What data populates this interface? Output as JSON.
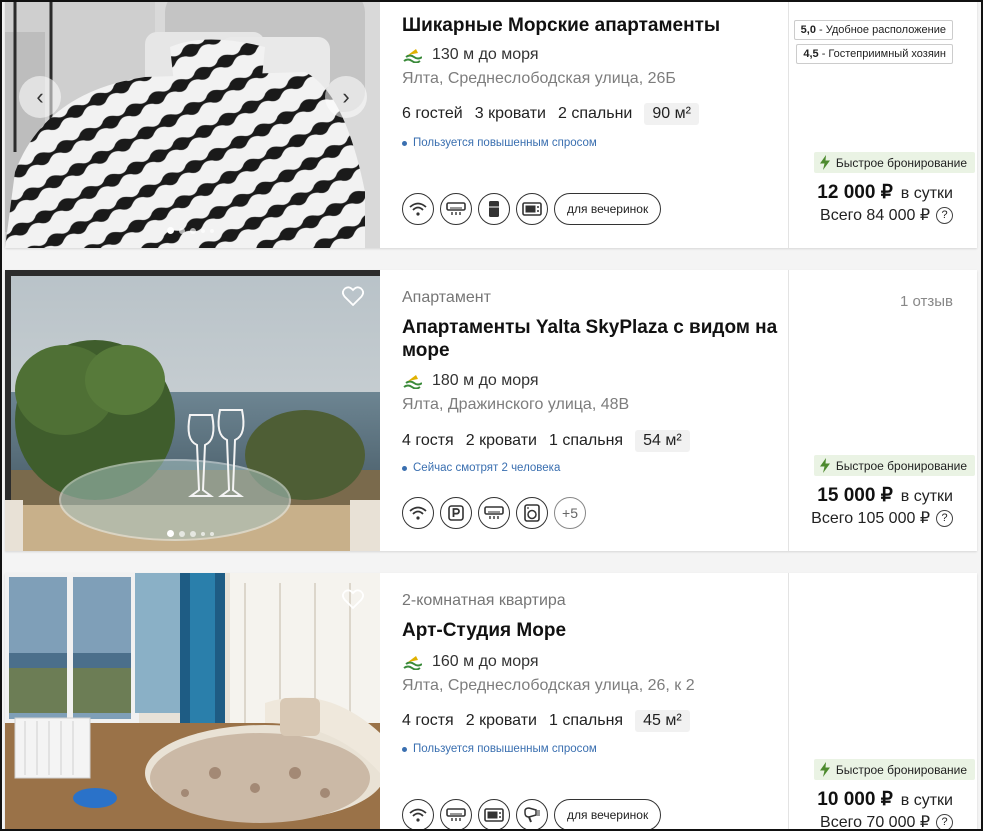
{
  "listings": [
    {
      "property_type": "",
      "title": "Шикарные Морские апартаменты",
      "sea_distance": "130 м до моря",
      "address": "Ялта, Среднеслободская улица, 26Б",
      "guests": "6 гостей",
      "beds": "3 кровати",
      "bedrooms": "2 спальни",
      "area": "90 м²",
      "note": "Пользуется повышенным спросом",
      "amenity_icons": [
        "wifi-icon",
        "air-conditioner-icon",
        "fridge-icon",
        "microwave-icon"
      ],
      "tag": "для вечеринок",
      "ratings": [
        {
          "score": "5,0",
          "label": "Удобное расположение"
        },
        {
          "score": "4,5",
          "label": "Гостеприимный хозяин"
        }
      ],
      "badge": "Быстрое бронирование",
      "price": "12 000 ₽",
      "price_unit": "в сутки",
      "total": "Всего 84 000 ₽",
      "total_help": "?"
    },
    {
      "property_type": "Апартамент",
      "title": "Апартаменты Yalta SkyPlaza с видом на море",
      "sea_distance": "180 м до моря",
      "address": "Ялта, Дражинского улица, 48В",
      "guests": "4 гостя",
      "beds": "2 кровати",
      "bedrooms": "1 спальня",
      "area": "54 м²",
      "note": "Сейчас смотрят 2 человека",
      "amenity_icons": [
        "wifi-icon",
        "parking-icon",
        "air-conditioner-icon",
        "washing-machine-icon"
      ],
      "more": "+5",
      "reviews": "1 отзыв",
      "badge": "Быстрое бронирование",
      "price": "15 000 ₽",
      "price_unit": "в сутки",
      "total": "Всего 105 000 ₽",
      "total_help": "?"
    },
    {
      "property_type": "2-комнатная квартира",
      "title": "Арт-Студия Море",
      "sea_distance": "160 м до моря",
      "address": "Ялта, Среднеслободская улица, 26, к 2",
      "guests": "4 гостя",
      "beds": "2 кровати",
      "bedrooms": "1 спальня",
      "area": "45 м²",
      "note": "Пользуется повышенным спросом",
      "amenity_icons": [
        "wifi-icon",
        "air-conditioner-icon",
        "microwave-icon",
        "hairdryer-icon"
      ],
      "tag": "для вечеринок",
      "badge": "Быстрое бронирование",
      "price": "10 000 ₽",
      "price_unit": "в сутки",
      "total": "Всего 70 000 ₽",
      "total_help": "?"
    }
  ],
  "colors": {
    "badge_bg": "#eaf3e4",
    "lightning": "#4d8a2e",
    "note": "#3a6fb0"
  }
}
